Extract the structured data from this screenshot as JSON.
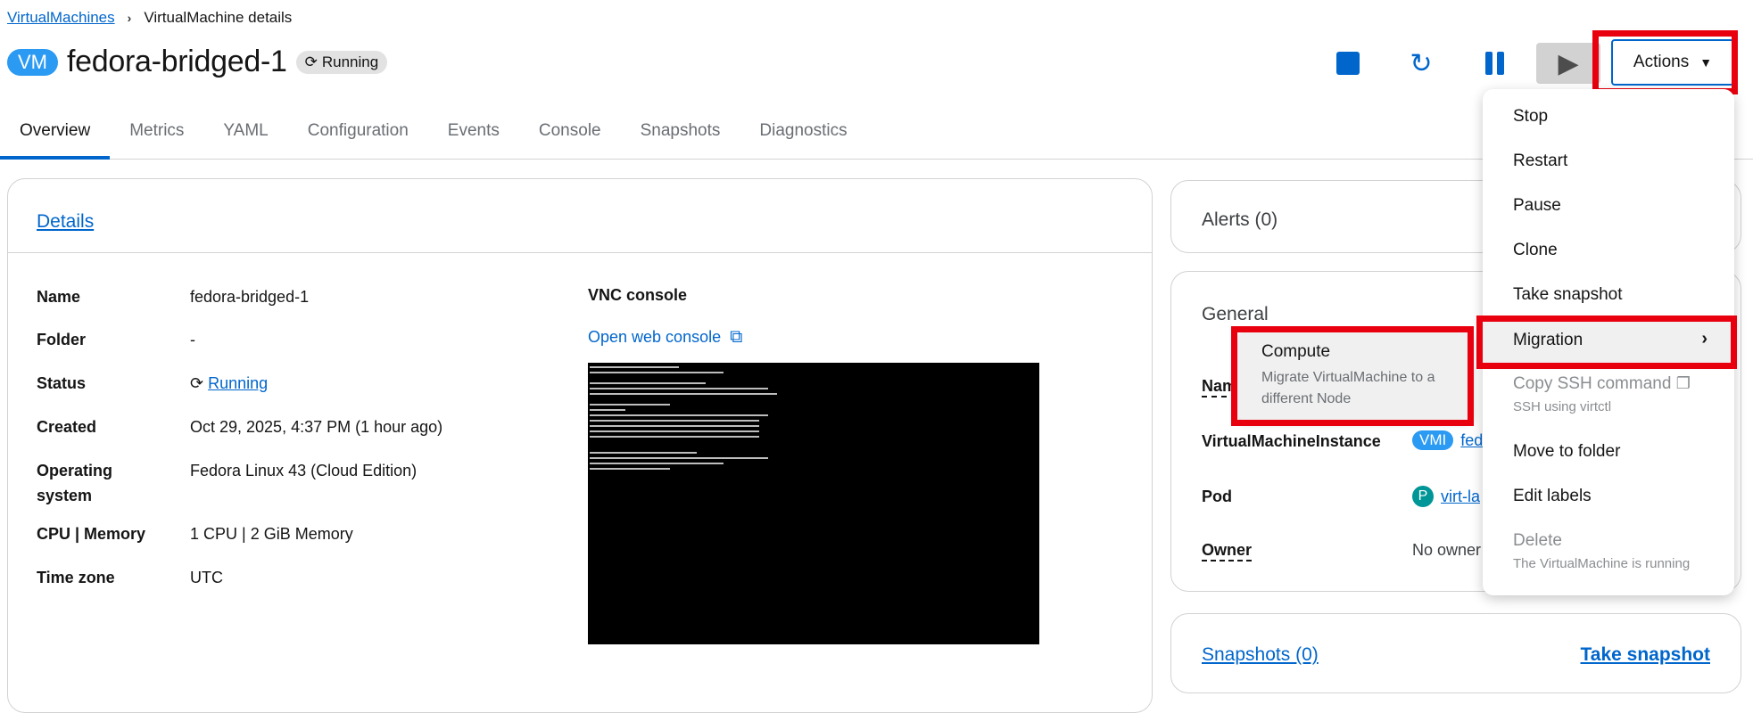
{
  "breadcrumb": {
    "root": "VirtualMachines",
    "separator": "›",
    "current": "VirtualMachine details"
  },
  "header": {
    "badge": "VM",
    "name": "fedora-bridged-1",
    "status": "Running",
    "actions_label": "Actions"
  },
  "tabs": [
    "Overview",
    "Metrics",
    "YAML",
    "Configuration",
    "Events",
    "Console",
    "Snapshots",
    "Diagnostics"
  ],
  "details": {
    "title": "Details",
    "rows": [
      {
        "label": "Name",
        "value": "fedora-bridged-1"
      },
      {
        "label": "Folder",
        "value": "-"
      },
      {
        "label": "Status",
        "value": "Running"
      },
      {
        "label": "Created",
        "value": "Oct 29, 2025, 4:37 PM (1 hour ago)"
      },
      {
        "label": "Operating system",
        "value": "Fedora Linux 43 (Cloud Edition)"
      },
      {
        "label": "CPU | Memory",
        "value": "1 CPU | 2 GiB Memory"
      },
      {
        "label": "Time zone",
        "value": "UTC"
      }
    ],
    "vnc_title": "VNC console",
    "vnc_link": "Open web console"
  },
  "alerts": {
    "title": "Alerts (0)"
  },
  "general": {
    "title": "General",
    "rows": [
      {
        "label": "Nam",
        "value": ""
      },
      {
        "label": "VirtualMachineInstance",
        "badge": "VMI",
        "value": "fed"
      },
      {
        "label": "Pod",
        "badge": "P",
        "value": "virt-la"
      },
      {
        "label": "Owner",
        "value": "No owner"
      }
    ]
  },
  "snapshots": {
    "title": "Snapshots (0)",
    "action": "Take snapshot"
  },
  "menu": {
    "items": [
      {
        "label": "Stop"
      },
      {
        "label": "Restart"
      },
      {
        "label": "Pause"
      },
      {
        "label": "Clone"
      },
      {
        "label": "Take snapshot"
      },
      {
        "label": "Migration"
      },
      {
        "label": "Copy SSH command",
        "sub": "SSH using virtctl",
        "disabled": true
      },
      {
        "label": "Move to folder"
      },
      {
        "label": "Edit labels"
      },
      {
        "label": "Delete",
        "sub": "The VirtualMachine is running",
        "disabled": true
      }
    ]
  },
  "submenu": {
    "label": "Compute",
    "description": "Migrate VirtualMachine to a different Node"
  },
  "colors": {
    "accent": "#0066cc",
    "highlight_box": "#e8000f",
    "vm_badge": "#2b9af3"
  },
  "icons": [
    "stop-icon",
    "restart-icon",
    "pause-icon",
    "play-icon",
    "caret-down-icon",
    "sync-icon",
    "external-link-icon",
    "chevron-right-icon",
    "copy-icon"
  ]
}
